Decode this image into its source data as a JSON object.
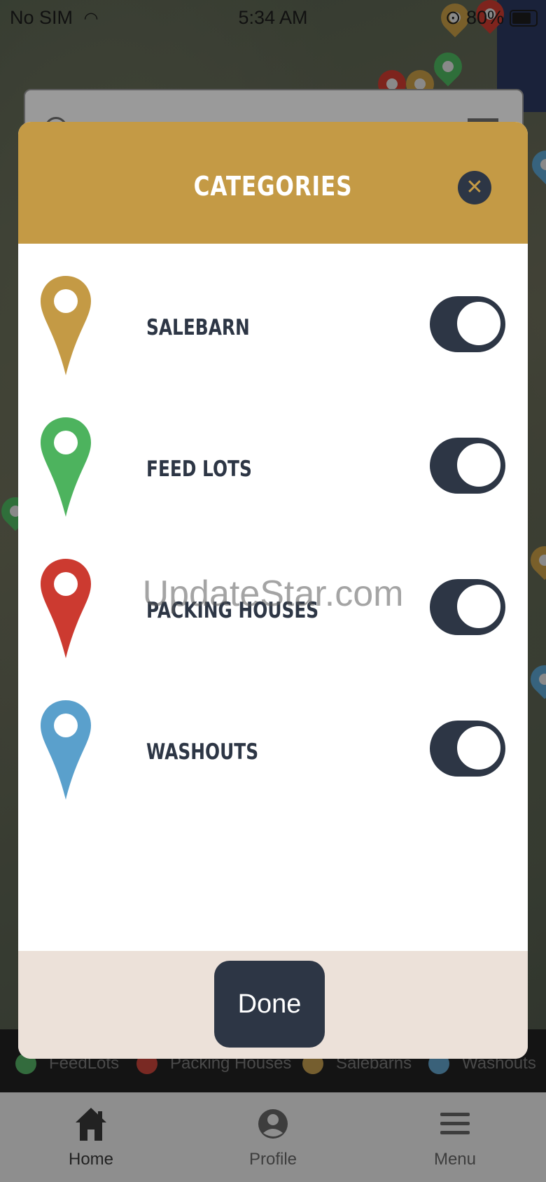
{
  "status_bar": {
    "carrier": "No SIM",
    "time": "5:34 AM",
    "battery": "80%",
    "wifi_icon": "wifi-icon",
    "lock_icon": "orientation-lock-icon",
    "battery_icon": "battery-icon"
  },
  "modal": {
    "title": "CATEGORIES",
    "close_icon": "close-icon",
    "categories": [
      {
        "label": "SALEBARN",
        "color": "#c49a45",
        "enabled": true
      },
      {
        "label": "FEED LOTS",
        "color": "#4db35e",
        "enabled": true
      },
      {
        "label": "PACKING HOUSES",
        "color": "#cc3a30",
        "enabled": true
      },
      {
        "label": "WASHOUTS",
        "color": "#5aa0cc",
        "enabled": true
      }
    ],
    "done_label": "Done"
  },
  "legend": [
    {
      "label": "FeedLots",
      "color": "#4db35e"
    },
    {
      "label": "Packing Houses",
      "color": "#cc3a30"
    },
    {
      "label": "Salebarns",
      "color": "#c49a45"
    },
    {
      "label": "Washouts",
      "color": "#5aa0cc"
    }
  ],
  "tabbar": {
    "tabs": [
      {
        "label": "Home",
        "icon": "home-icon",
        "active": true
      },
      {
        "label": "Profile",
        "icon": "profile-icon",
        "active": false
      },
      {
        "label": "Menu",
        "icon": "menu-icon",
        "active": false
      }
    ]
  },
  "watermark": "UpdateStar.com",
  "colors": {
    "accent": "#c49a45",
    "dark": "#2d3645",
    "footer": "#ece1d9"
  }
}
